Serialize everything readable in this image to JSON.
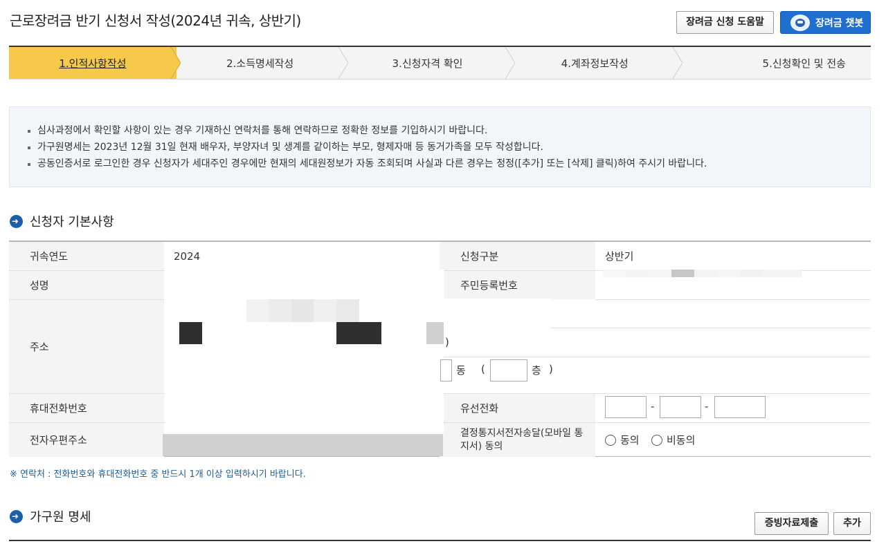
{
  "header": {
    "title": "근로장려금 반기 신청서 작성(2024년 귀속, 상반기)",
    "help_button": "장려금 신청 도움말",
    "chatbot_button": "장려금 챗봇"
  },
  "steps": [
    {
      "label": "1.인적사항작성",
      "active": true
    },
    {
      "label": "2.소득명세작성",
      "active": false
    },
    {
      "label": "3.신청자격 확인",
      "active": false
    },
    {
      "label": "4.계좌정보작성",
      "active": false
    },
    {
      "label": "5.신청확인 및 전송",
      "active": false
    }
  ],
  "notices": [
    "심사과정에서 확인할 사항이 있는 경우 기재하신 연락처를 통해 연락하므로 정확한 정보를 기입하시기 바랍니다.",
    "가구원명세는 2023년 12월 31일 현재 배우자, 부양자녀 및 생계를 같이하는 부모, 형제자매 등 동거가족을 모두 작성합니다.",
    "공동인증서로 로그인한 경우 신청자가 세대주인 경우에만 현재의 세대원정보가 자동 조회되며 사실과 다른 경우는 정정([추가] 또는 [삭제] 클릭)하여 주시기 바랍니다."
  ],
  "basic_info": {
    "section_title": "신청자 기본사항",
    "year_label": "귀속연도",
    "year_value": "2024",
    "type_label": "신청구분",
    "type_value": "상반기",
    "name_label": "성명",
    "rrn_label": "주민등록번호",
    "address_label": "주소",
    "address_paren_close": ")",
    "dong_label": "동",
    "floor_open": "(",
    "floor_label": "층",
    "floor_close": ")",
    "mobile_label": "휴대전화번호",
    "landline_label": "유선전화",
    "landline_sep": "-",
    "email_label": "전자우편주소",
    "consent_label": "결정통지서전자송달(모바일 통지서) 동의",
    "consent_options": [
      "동의",
      "비동의"
    ]
  },
  "contact_note": "※ 연락처 : 전화번호와 휴대전화번호 중 반드시 1개 이상 입력하시기 바랍니다.",
  "household": {
    "section_title": "가구원 명세",
    "evidence_button": "증빙자료제출",
    "add_button": "추가"
  }
}
